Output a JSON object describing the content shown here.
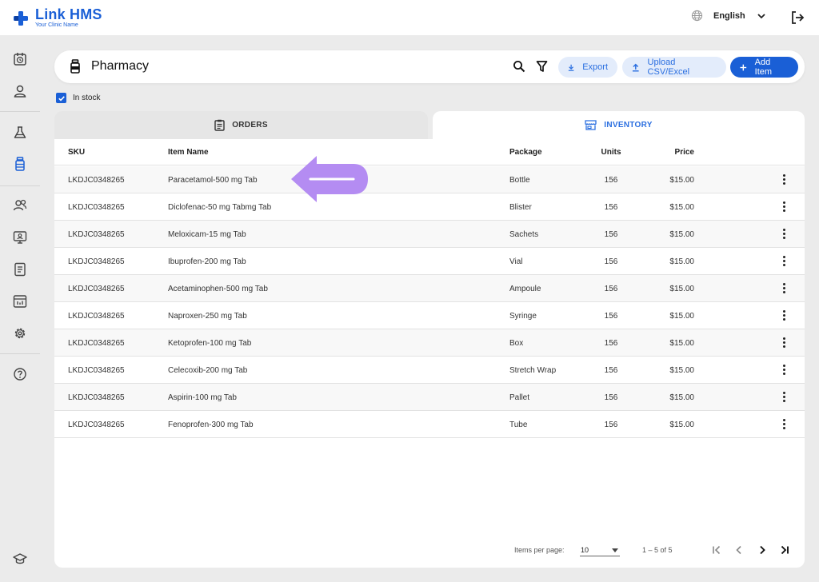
{
  "app": {
    "name": "Link HMS",
    "subtitle": "Your Clinic Name",
    "language": "English",
    "brand_color": "#1a5fd6"
  },
  "sidebar": {
    "items": [
      {
        "icon": "calendar-clock-icon",
        "active": false
      },
      {
        "icon": "user-icon",
        "active": false
      },
      {
        "icon": "lab-flask-icon",
        "active": false
      },
      {
        "icon": "pharmacy-bottle-icon",
        "active": true
      },
      {
        "icon": "staff-group-icon",
        "active": false
      },
      {
        "icon": "monitor-user-icon",
        "active": false
      },
      {
        "icon": "document-list-icon",
        "active": false
      },
      {
        "icon": "reports-chart-icon",
        "active": false
      },
      {
        "icon": "gear-icon",
        "active": false
      },
      {
        "icon": "help-icon",
        "active": false
      },
      {
        "icon": "graduation-cap-icon",
        "active": false
      }
    ]
  },
  "header": {
    "title": "Pharmacy",
    "export_label": "Export",
    "upload_label": "Upload CSV/Excel",
    "add_label": "Add Item"
  },
  "filters": {
    "in_stock_label": "In stock",
    "in_stock_checked": true
  },
  "tabs": [
    {
      "label": "ORDERS",
      "active": false
    },
    {
      "label": "INVENTORY",
      "active": true
    }
  ],
  "table": {
    "columns": [
      "SKU",
      "Item Name",
      "Package",
      "Units",
      "Price"
    ],
    "rows": [
      {
        "sku": "LKDJC0348265",
        "name": "Paracetamol-500 mg Tab",
        "package": "Bottle",
        "units": "156",
        "price": "$15.00"
      },
      {
        "sku": "LKDJC0348265",
        "name": "Diclofenac-50 mg Tabmg Tab",
        "package": "Blister",
        "units": "156",
        "price": "$15.00"
      },
      {
        "sku": "LKDJC0348265",
        "name": "Meloxicam-15 mg Tab",
        "package": "Sachets",
        "units": "156",
        "price": "$15.00"
      },
      {
        "sku": "LKDJC0348265",
        "name": "Ibuprofen-200 mg Tab",
        "package": "Vial",
        "units": "156",
        "price": "$15.00"
      },
      {
        "sku": "LKDJC0348265",
        "name": "Acetaminophen-500 mg Tab",
        "package": "Ampoule",
        "units": "156",
        "price": "$15.00"
      },
      {
        "sku": "LKDJC0348265",
        "name": "Naproxen-250 mg Tab",
        "package": "Syringe",
        "units": "156",
        "price": "$15.00"
      },
      {
        "sku": "LKDJC0348265",
        "name": "Ketoprofen-100 mg Tab",
        "package": "Box",
        "units": "156",
        "price": "$15.00"
      },
      {
        "sku": "LKDJC0348265",
        "name": "Celecoxib-200 mg Tab",
        "package": "Stretch Wrap",
        "units": "156",
        "price": "$15.00"
      },
      {
        "sku": "LKDJC0348265",
        "name": "Aspirin-100 mg Tab",
        "package": "Pallet",
        "units": "156",
        "price": "$15.00"
      },
      {
        "sku": "LKDJC0348265",
        "name": "Fenoprofen-300 mg Tab",
        "package": "Tube",
        "units": "156",
        "price": "$15.00"
      }
    ]
  },
  "pagination": {
    "items_per_page_label": "Items per page:",
    "items_per_page": "10",
    "range": "1 – 5 of 5"
  },
  "annotation": {
    "color": "#b48cf2",
    "icon": "arrow-left-icon"
  }
}
